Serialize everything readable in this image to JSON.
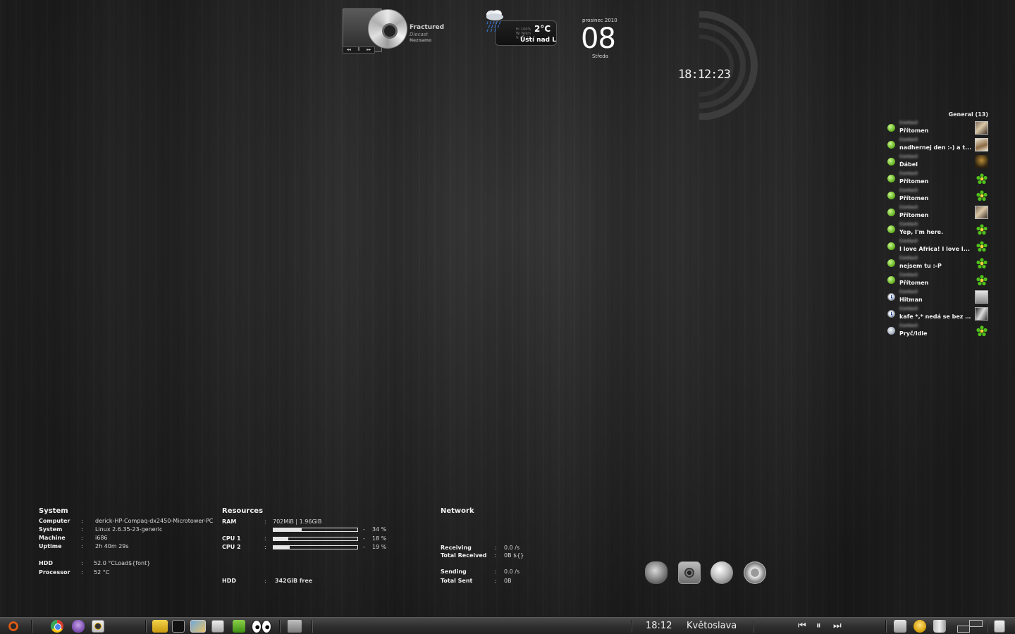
{
  "player": {
    "title": "Fractured",
    "artist": "Diecast",
    "album": "Neznamo",
    "controls": [
      "◂◂",
      "ll",
      "▸▸"
    ]
  },
  "weather": {
    "humidity": "H: 100%",
    "wind": "W: N/km",
    "visibility": "V: 0 - 13",
    "temperature": "2°C",
    "city": "Ústí nad L"
  },
  "date": {
    "month_year": "prosinec 2010",
    "day": "08",
    "weekday": "Středa"
  },
  "clock": {
    "time": "18:12:23"
  },
  "contacts": {
    "header": "General (13)",
    "items": [
      {
        "name": "Contact",
        "message": "Přítomen",
        "status": "online",
        "avatar": "av-photo"
      },
      {
        "name": "Contact",
        "message": "nadhernej den :-) a t...",
        "status": "online",
        "avatar": "av-photo2"
      },
      {
        "name": "Contact",
        "message": "Ďábel",
        "status": "online",
        "avatar": "av-dark"
      },
      {
        "name": "Contact",
        "message": "Přítomen",
        "status": "online",
        "avatar": "flower"
      },
      {
        "name": "Contact",
        "message": "Přítomen",
        "status": "online",
        "avatar": "flower"
      },
      {
        "name": "Contact",
        "message": "Přítomen",
        "status": "online",
        "avatar": "av-photo"
      },
      {
        "name": "Contact",
        "message": "Yep, I'm here.",
        "status": "online",
        "avatar": "flower"
      },
      {
        "name": "Contact",
        "message": "I love Africa! I love I...",
        "status": "online",
        "avatar": "flower"
      },
      {
        "name": "Contact",
        "message": "nejsem tu :-P",
        "status": "online",
        "avatar": "flower"
      },
      {
        "name": "Contact",
        "message": "Přítomen",
        "status": "online",
        "avatar": "flower"
      },
      {
        "name": "Contact",
        "message": "Hitman",
        "status": "away",
        "avatar": "av-gray"
      },
      {
        "name": "Contact",
        "message": "kafe *,* nedá se bez něj...",
        "status": "away",
        "avatar": "av-bw"
      },
      {
        "name": "Contact",
        "message": "Pryč/Idle",
        "status": "offline",
        "avatar": "flower"
      }
    ]
  },
  "system": {
    "title": "System",
    "computer_label": "Computer",
    "computer": "derick-HP-Compaq-dx2450-Microtower-PC",
    "system_label": "System",
    "system": "Linux    2.6.35-23-generic",
    "machine_label": "Machine",
    "machine": "i686",
    "uptime_label": "Uptime",
    "uptime": "2h 40m 29s",
    "hdd_label": "HDD",
    "hdd": "52.0 °CLoad${font}",
    "processor_label": "Processor",
    "processor": "52 °C"
  },
  "resources": {
    "title": "Resources",
    "ram_label": "RAM",
    "ram": "702MiB   |   1.96GiB",
    "ram_percent": "34 %",
    "ram_fill": 0.34,
    "cpu1_label": "CPU 1",
    "cpu1_percent": "18 %",
    "cpu1_fill": 0.18,
    "cpu2_label": "CPU 2",
    "cpu2_percent": "19 %",
    "cpu2_fill": 0.19,
    "hdd_label": "HDD",
    "hdd": "342GiB free"
  },
  "network": {
    "title": "Network",
    "receiving_label": "Receiving",
    "receiving": "0.0 /s",
    "total_received_label": "Total Received",
    "total_received": "0B  ${}",
    "sending_label": "Sending",
    "sending": "0.0 /s",
    "total_sent_label": "Total Sent",
    "total_sent": "0B"
  },
  "taskbar": {
    "time": "18:12",
    "nameday": "Květoslava",
    "media_prev": "⏮",
    "media_pause": "⏸",
    "media_next": "⏭"
  },
  "colors": {
    "accent": "#e6e6e6",
    "online": "#5fae1e"
  }
}
